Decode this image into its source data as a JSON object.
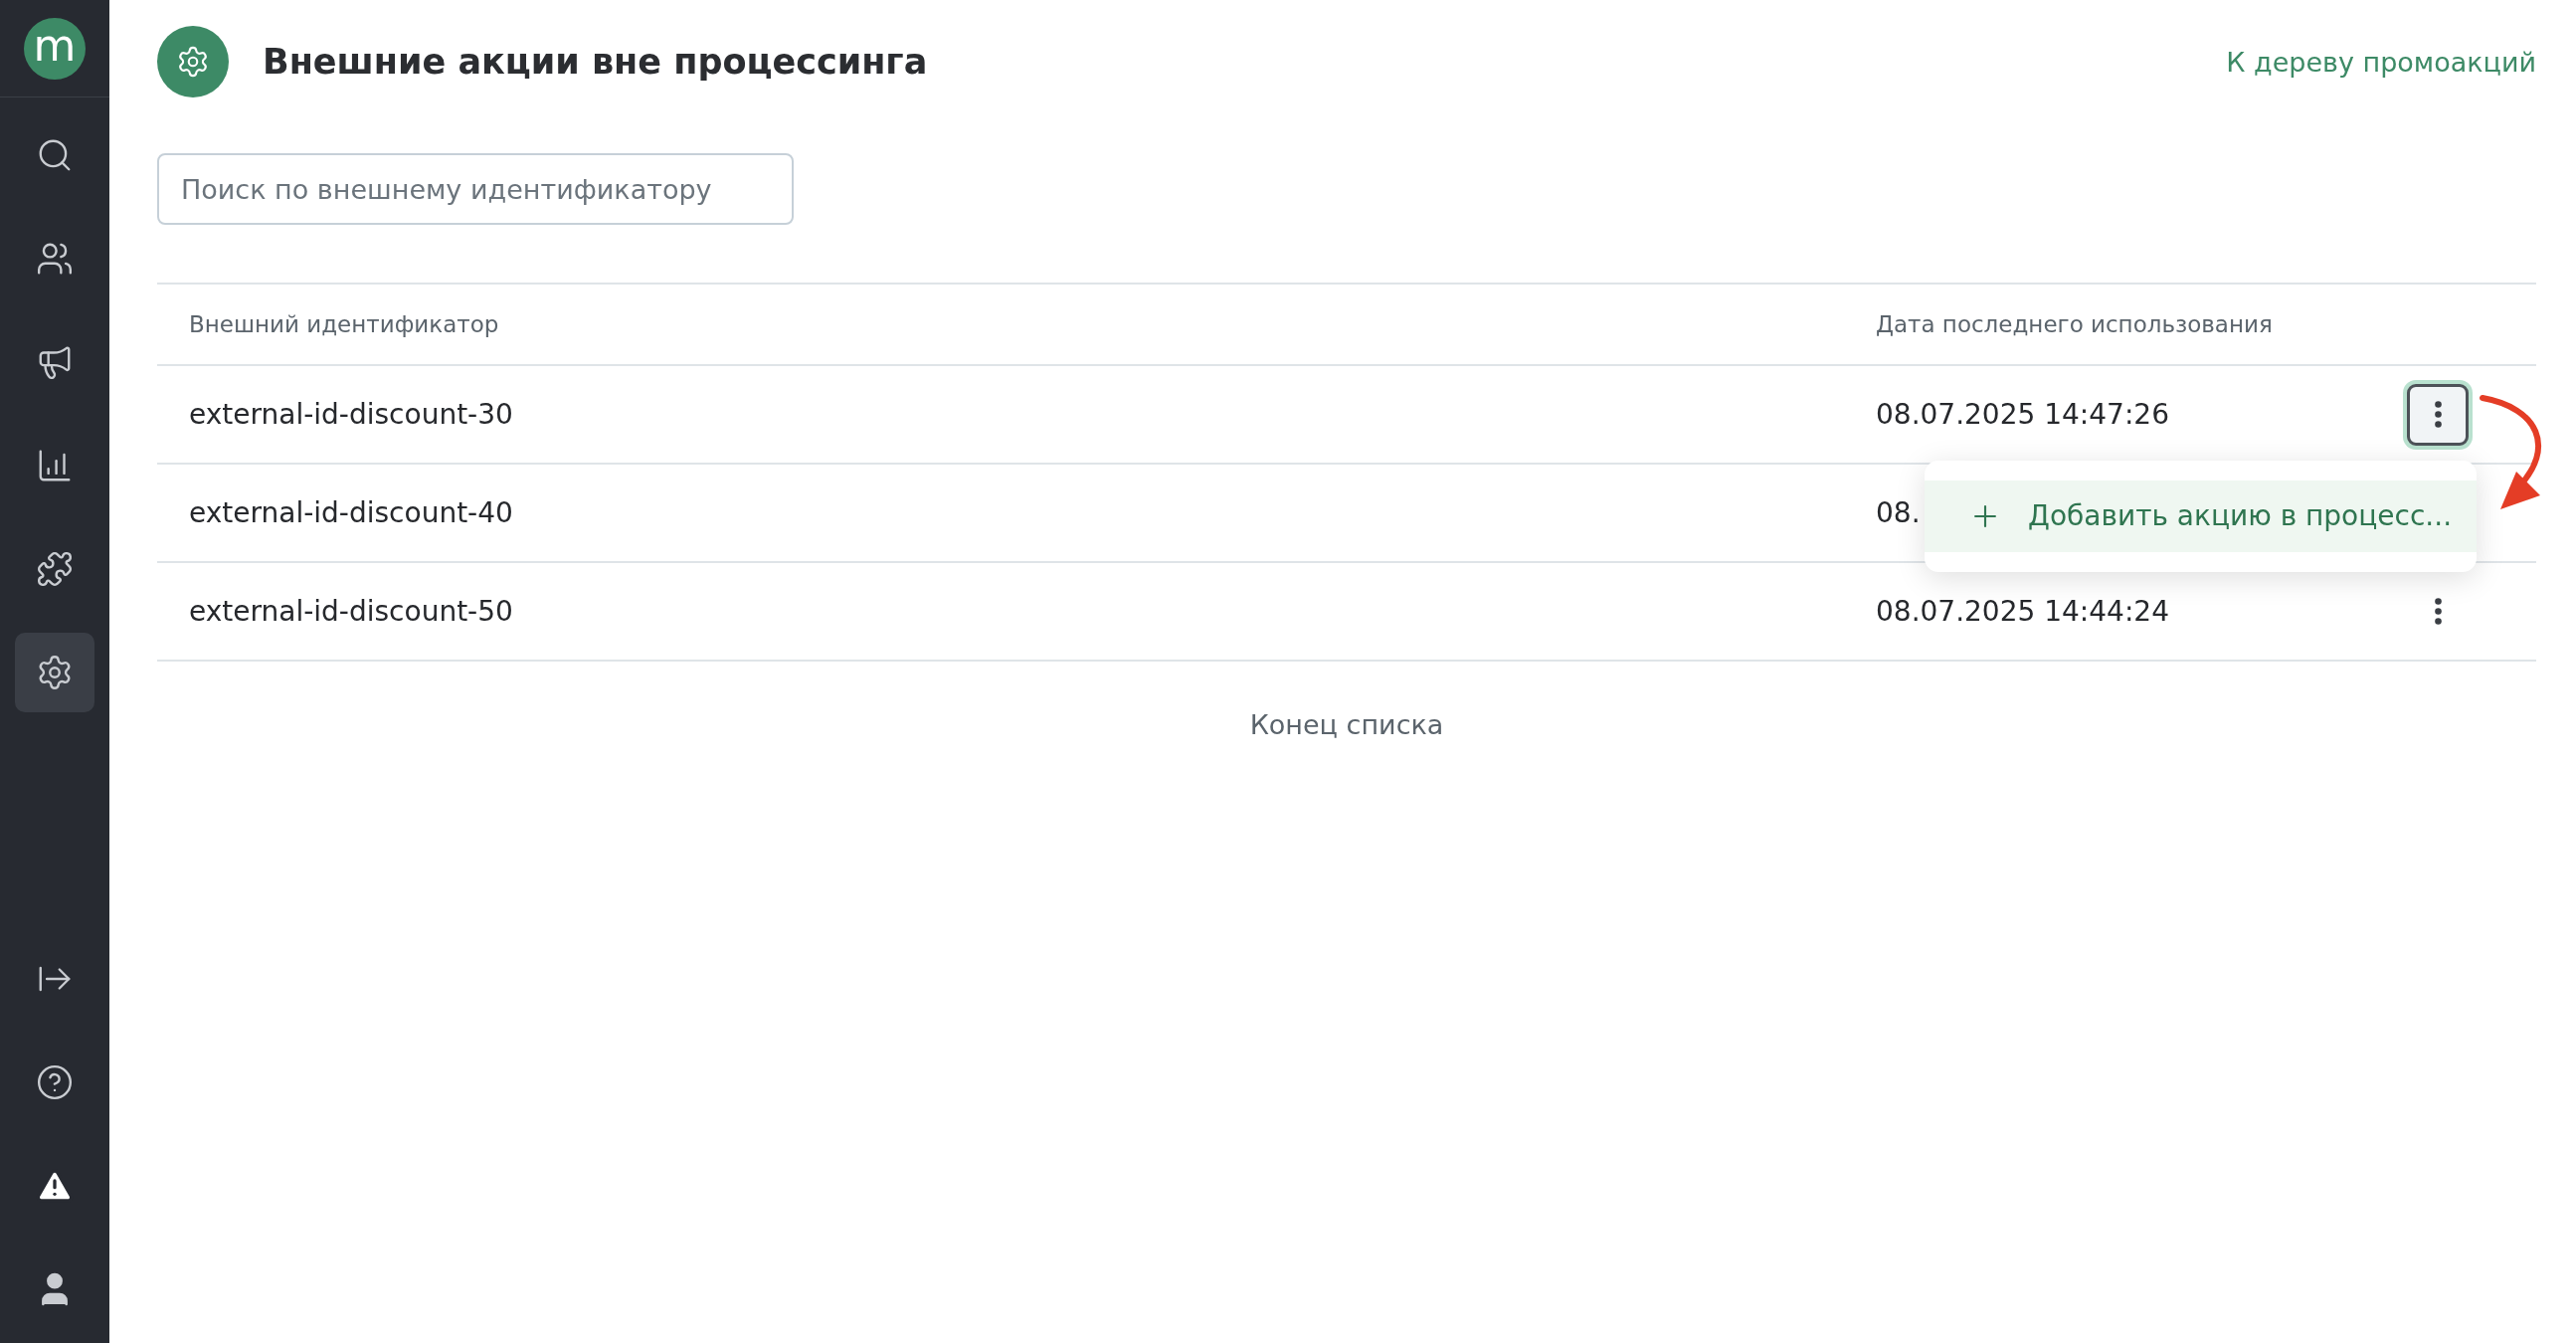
{
  "sidebar": {
    "logo": "m",
    "nav": [
      {
        "kind": "search",
        "selected": false
      },
      {
        "kind": "users",
        "selected": false
      },
      {
        "kind": "megaphone",
        "selected": false
      },
      {
        "kind": "chart",
        "selected": false
      },
      {
        "kind": "puzzle",
        "selected": false
      },
      {
        "kind": "settings",
        "selected": true
      }
    ],
    "bottom": [
      {
        "kind": "exit"
      },
      {
        "kind": "help"
      },
      {
        "kind": "alert"
      },
      {
        "kind": "user"
      }
    ]
  },
  "header": {
    "title": "Внешние акции вне процессинга",
    "link": "К дереву промоакций"
  },
  "search": {
    "placeholder": "Поиск по внешнему идентификатору"
  },
  "table": {
    "columns": [
      "Внешний идентификатор",
      "Дата последнего использования"
    ],
    "rows": [
      {
        "id": "external-id-discount-30",
        "date": "08.07.2025 14:47:26",
        "menu_open": true
      },
      {
        "id": "external-id-discount-40",
        "date": "08.",
        "menu_open": false
      },
      {
        "id": "external-id-discount-50",
        "date": "08.07.2025 14:44:24",
        "menu_open": false
      }
    ]
  },
  "menu": {
    "items": [
      {
        "label": "Добавить акцию в процесс...",
        "highlighted": true
      }
    ]
  },
  "footer": "Конец списка"
}
